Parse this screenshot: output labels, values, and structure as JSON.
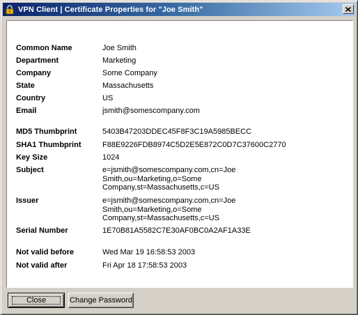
{
  "window": {
    "title": "VPN Client   |   Certificate Properties for \"Joe Smith\"",
    "app_icon": "padlock-icon",
    "close_glyph": "✕"
  },
  "certificate": {
    "common_name": {
      "label": "Common Name",
      "value": "Joe Smith"
    },
    "department": {
      "label": "Department",
      "value": "Marketing"
    },
    "company": {
      "label": "Company",
      "value": "Some Company"
    },
    "state": {
      "label": "State",
      "value": "Massachusetts"
    },
    "country": {
      "label": "Country",
      "value": "US"
    },
    "email": {
      "label": "Email",
      "value": "jsmith@somescompany.com"
    },
    "md5": {
      "label": "MD5 Thumbprint",
      "value": "5403B47203DDEC45F8F3C19A5985BECC"
    },
    "sha1": {
      "label": "SHA1 Thumbprint",
      "value": "F88E9226FDB8974C5D2E5E872C0D7C37600C2770"
    },
    "key_size": {
      "label": "Key Size",
      "value": "1024"
    },
    "subject": {
      "label": "Subject",
      "value": "e=jsmith@somescompany.com,cn=Joe\nSmith,ou=Marketing,o=Some\nCompany,st=Massachusetts,c=US"
    },
    "issuer": {
      "label": "Issuer",
      "value": "e=jsmith@somescompany.com,cn=Joe\nSmith,ou=Marketing,o=Some\nCompany,st=Massachusetts,c=US"
    },
    "serial": {
      "label": "Serial Number",
      "value": "1E70B81A5582C7E30AF0BC0A2AF1A33E"
    },
    "not_before": {
      "label": "Not valid before",
      "value": "Wed Mar 19 16:58:53 2003"
    },
    "not_after": {
      "label": "Not valid after",
      "value": "Fri Apr 18 17:58:53 2003"
    }
  },
  "buttons": {
    "close": "Close",
    "change_password": "Change Password"
  },
  "colors": {
    "title_gradient_start": "#0a246a",
    "title_gradient_end": "#a6caf0",
    "face": "#d4d0c8",
    "panel": "#ffffff"
  }
}
